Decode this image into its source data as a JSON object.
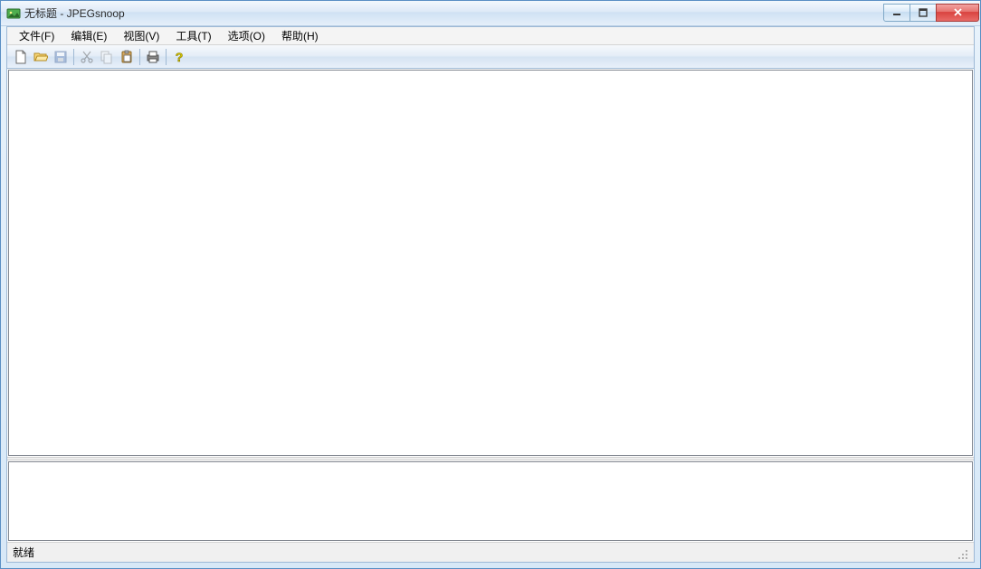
{
  "window": {
    "title": "无标题 - JPEGsnoop"
  },
  "menu": {
    "file": "文件(F)",
    "edit": "编辑(E)",
    "view": "视图(V)",
    "tools": "工具(T)",
    "options": "选项(O)",
    "help": "帮助(H)"
  },
  "status": {
    "text": "就绪"
  }
}
